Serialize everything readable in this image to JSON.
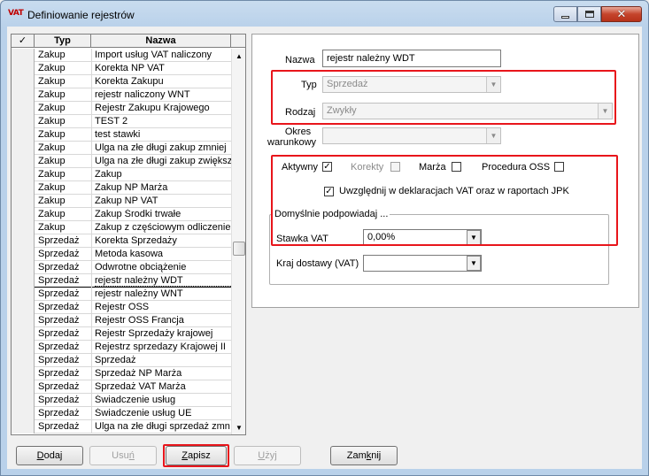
{
  "window": {
    "title": "Definiowanie rejestrów",
    "app_icon_text": "VAT"
  },
  "grid": {
    "header_check": "✓",
    "header_typ": "Typ",
    "header_nazwa": "Nazwa",
    "rows": [
      {
        "typ": "Zakup",
        "nazwa": "Import usług VAT naliczony"
      },
      {
        "typ": "Zakup",
        "nazwa": "Korekta NP VAT"
      },
      {
        "typ": "Zakup",
        "nazwa": "Korekta Zakupu"
      },
      {
        "typ": "Zakup",
        "nazwa": "rejestr naliczony WNT"
      },
      {
        "typ": "Zakup",
        "nazwa": "Rejestr Zakupu Krajowego"
      },
      {
        "typ": "Zakup",
        "nazwa": "TEST 2"
      },
      {
        "typ": "Zakup",
        "nazwa": "test stawki"
      },
      {
        "typ": "Zakup",
        "nazwa": "Ulga na złe długi zakup zmniej"
      },
      {
        "typ": "Zakup",
        "nazwa": "Ulga na złe długi zakup zwiększ"
      },
      {
        "typ": "Zakup",
        "nazwa": "Zakup"
      },
      {
        "typ": "Zakup",
        "nazwa": "Zakup NP Marża"
      },
      {
        "typ": "Zakup",
        "nazwa": "Zakup NP VAT"
      },
      {
        "typ": "Zakup",
        "nazwa": "Zakup Środki trwałe"
      },
      {
        "typ": "Zakup",
        "nazwa": "Zakup z częściowym odliczenie"
      },
      {
        "typ": "Sprzedaż",
        "nazwa": "Korekta Sprzedaży"
      },
      {
        "typ": "Sprzedaż",
        "nazwa": "Metoda kasowa"
      },
      {
        "typ": "Sprzedaż",
        "nazwa": "Odwrotne obciążenie"
      },
      {
        "typ": "Sprzedaż",
        "nazwa": "rejestr należny WDT"
      },
      {
        "typ": "Sprzedaż",
        "nazwa": "rejestr należny WNT"
      },
      {
        "typ": "Sprzedaż",
        "nazwa": "Rejestr OSS"
      },
      {
        "typ": "Sprzedaż",
        "nazwa": "Rejestr OSS Francja"
      },
      {
        "typ": "Sprzedaż",
        "nazwa": "Rejestr Sprzedaży krajowej"
      },
      {
        "typ": "Sprzedaż",
        "nazwa": "Rejestrz sprzedazy Krajowej II"
      },
      {
        "typ": "Sprzedaż",
        "nazwa": "Sprzedaż"
      },
      {
        "typ": "Sprzedaż",
        "nazwa": "Sprzedaż NP Marża"
      },
      {
        "typ": "Sprzedaż",
        "nazwa": "Sprzedaż VAT Marża"
      },
      {
        "typ": "Sprzedaż",
        "nazwa": "Świadczenie usług"
      },
      {
        "typ": "Sprzedaż",
        "nazwa": "Świadczenie usług UE"
      },
      {
        "typ": "Sprzedaż",
        "nazwa": "Ulga na złe długi sprzedaż zmn"
      }
    ],
    "selected_index": 17
  },
  "form": {
    "nazwa_label": "Nazwa",
    "nazwa_value": "rejestr należny WDT",
    "typ_label": "Typ",
    "typ_value": "Sprzedaż",
    "rodzaj_label": "Rodzaj",
    "rodzaj_value": "Zwykły",
    "okres_label_1": "Okres",
    "okres_label_2": "warunkowy",
    "okres_value": "",
    "aktywny_label": "Aktywny",
    "aktywny_checked": "✓",
    "korekty_label": "Korekty",
    "marza_label": "Marża",
    "oss_label": "Procedura OSS",
    "uwzglednij_label": "Uwzględnij w deklaracjach VAT oraz w raportach JPK",
    "uwzglednij_checked": "✓",
    "group_title": "Domyślnie podpowiadaj ...",
    "stawka_label": "Stawka VAT",
    "stawka_value": "0,00%",
    "kraj_label": "Kraj dostawy (VAT)",
    "kraj_value": ""
  },
  "buttons": {
    "dodaj_u": "D",
    "dodaj_rest": "odaj",
    "usun_pre": "Usu",
    "usun_u": "ń",
    "zapisz_u": "Z",
    "zapisz_rest": "apisz",
    "uzyj_u": "U",
    "uzyj_rest": "żyj",
    "zamknij_pre": "Zam",
    "zamknij_u": "k",
    "zamknij_rest": "nij"
  },
  "colors": {
    "highlight_red": "#e8151b",
    "title_icon_red": "#c00000"
  }
}
